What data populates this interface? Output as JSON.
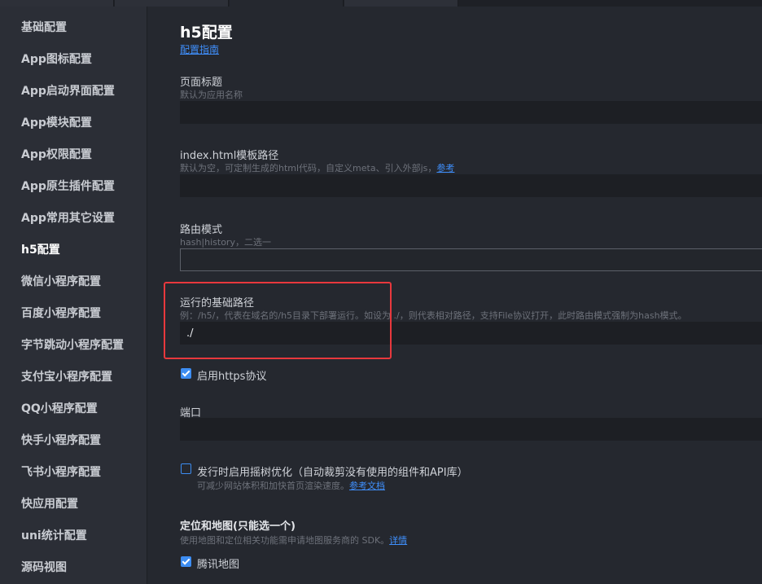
{
  "sidebar": {
    "items": [
      {
        "label": "基础配置"
      },
      {
        "label": "App图标配置"
      },
      {
        "label": "App启动界面配置"
      },
      {
        "label": "App模块配置"
      },
      {
        "label": "App权限配置"
      },
      {
        "label": "App原生插件配置"
      },
      {
        "label": "App常用其它设置"
      },
      {
        "label": "h5配置"
      },
      {
        "label": "微信小程序配置"
      },
      {
        "label": "百度小程序配置"
      },
      {
        "label": "字节跳动小程序配置"
      },
      {
        "label": "支付宝小程序配置"
      },
      {
        "label": "QQ小程序配置"
      },
      {
        "label": "快手小程序配置"
      },
      {
        "label": "飞书小程序配置"
      },
      {
        "label": "快应用配置"
      },
      {
        "label": "uni统计配置"
      },
      {
        "label": "源码视图"
      }
    ],
    "active": "h5配置"
  },
  "main": {
    "title": "h5配置",
    "guide_link": "配置指南",
    "page_title": {
      "label": "页面标题",
      "hint": "默认为应用名称",
      "value": ""
    },
    "template_path": {
      "label": "index.html模板路径",
      "hint": "默认为空，可定制生成的html代码，自定义meta、引入外部js，",
      "hint_link": "参考",
      "value": ""
    },
    "router_mode": {
      "label": "路由模式",
      "hint": "hash|history，二选一",
      "value": ""
    },
    "base_path": {
      "label": "运行的基础路径",
      "hint": "例：/h5/，代表在域名的/h5目录下部署运行。如设为 ./，则代表相对路径，支持File协议打开，此时路由模式强制为hash模式。",
      "value": "./"
    },
    "https": {
      "label": "启用https协议",
      "checked": true
    },
    "port": {
      "label": "端口",
      "value": ""
    },
    "tree_shaking": {
      "label": "发行时启用摇树优化（自动裁剪没有使用的组件和API库）",
      "hint": "可减少网站体积和加快首页渲染速度。",
      "hint_link": "参考文档",
      "checked": false
    },
    "map": {
      "label": "定位和地图(只能选一个)",
      "hint": "使用地图和定位相关功能需申请地图服务商的 SDK。",
      "hint_link": "详情",
      "tencent_label": "腾讯地图",
      "tencent_checked": true
    }
  }
}
